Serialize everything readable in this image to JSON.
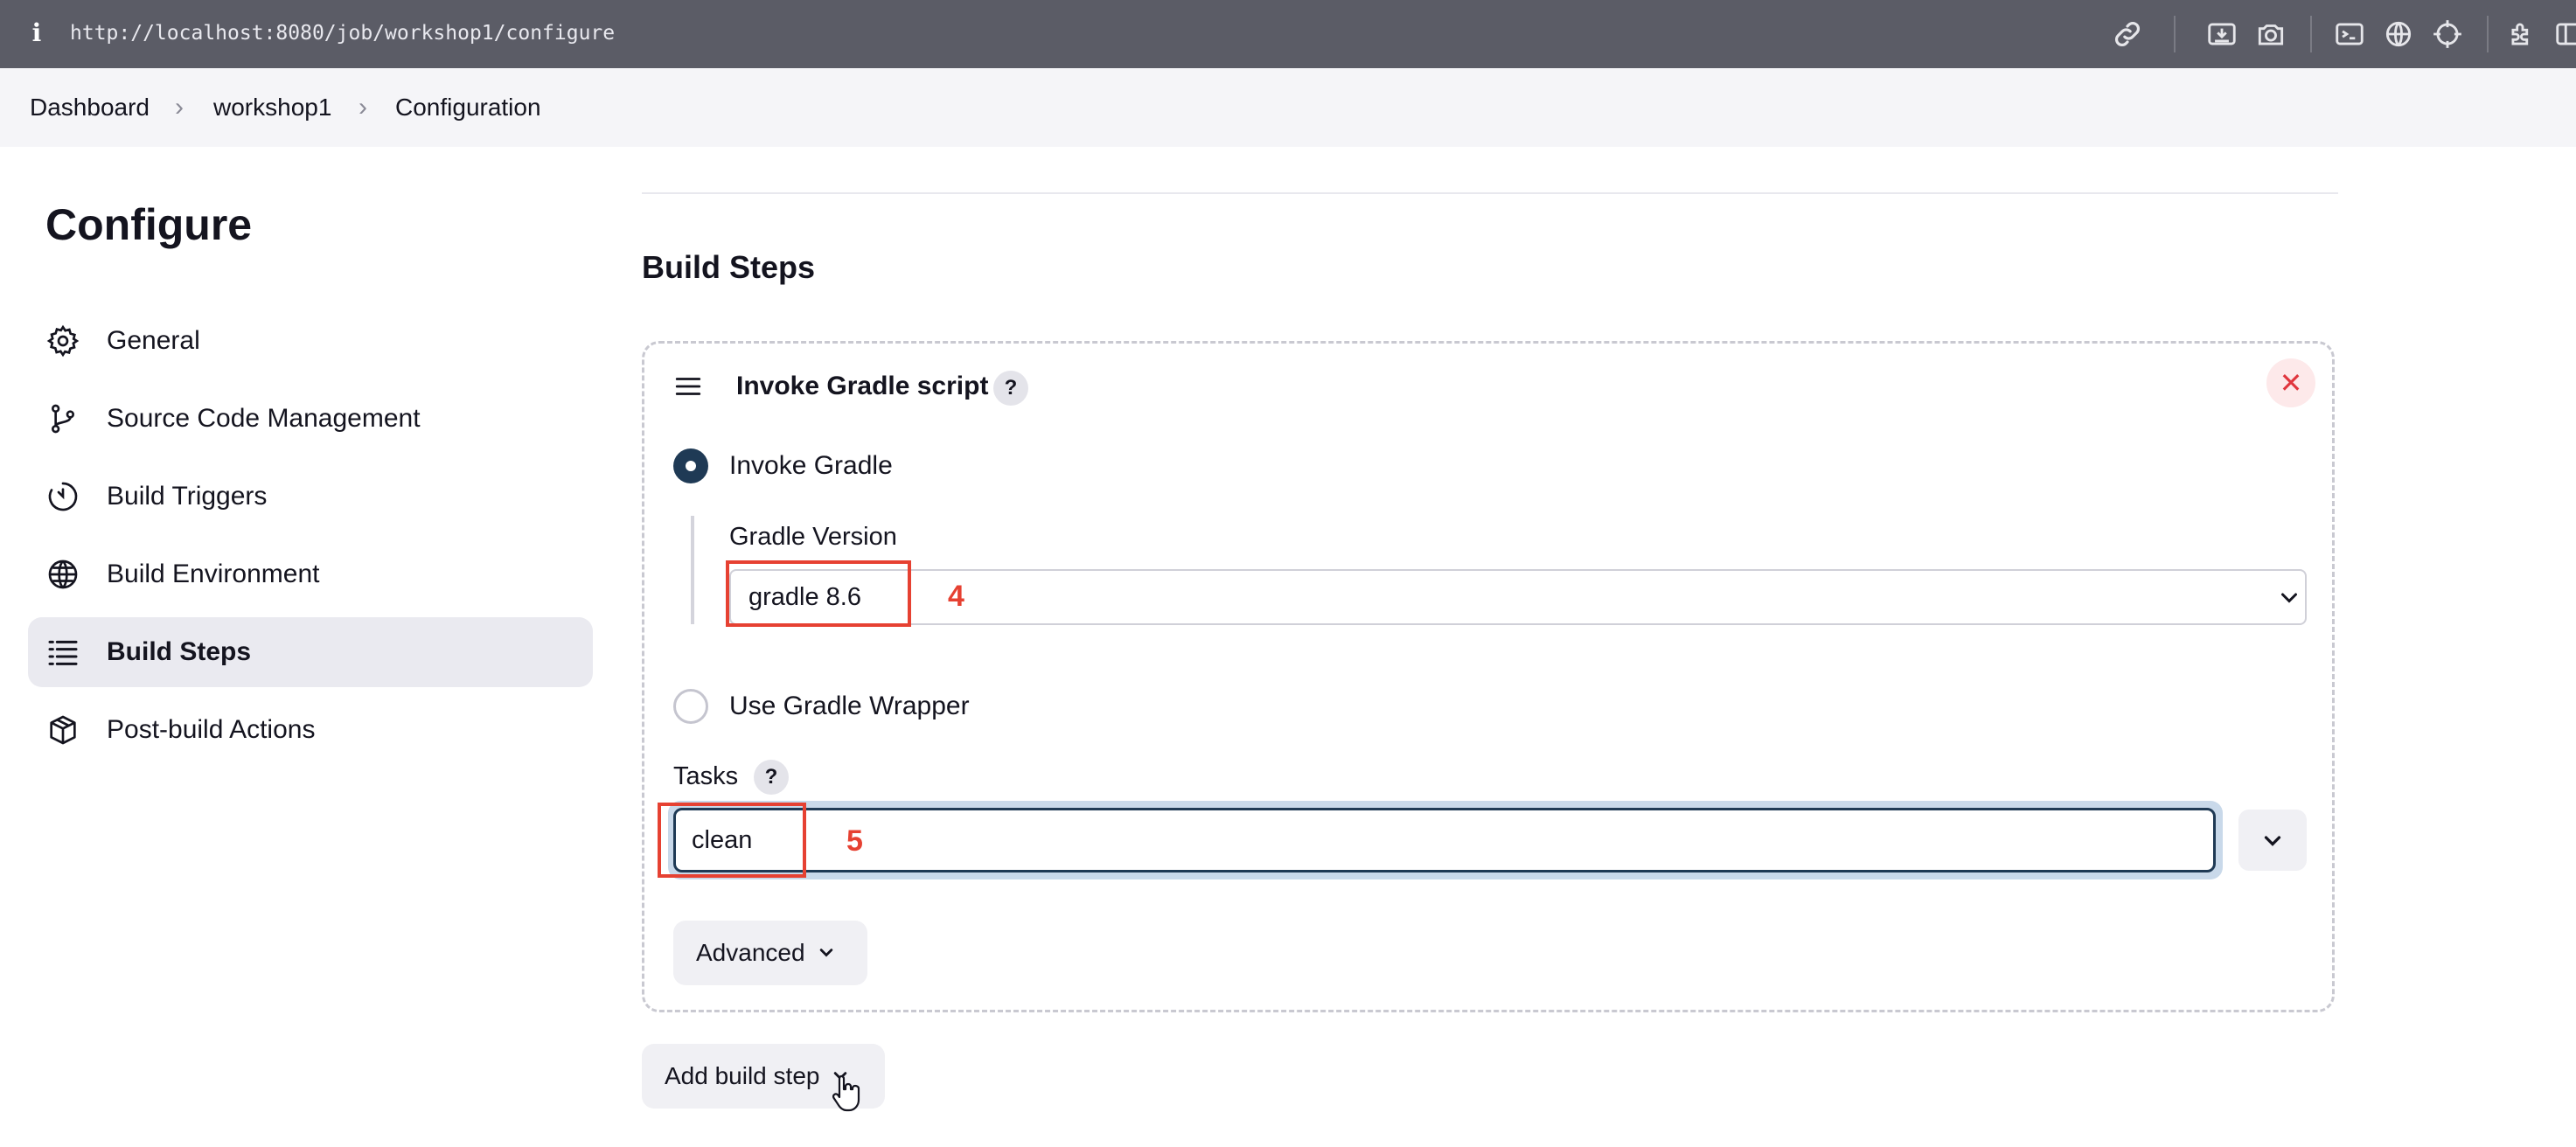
{
  "browser": {
    "url": "http://localhost:8080/job/workshop1/configure",
    "toolbar_icons": [
      "link-icon",
      "screenshot-icon",
      "camera-icon",
      "terminal-icon",
      "globe-icon",
      "crosshair-icon",
      "extensions-icon",
      "sidebar-icon"
    ]
  },
  "breadcrumb": [
    "Dashboard",
    "workshop1",
    "Configuration"
  ],
  "sidebar": {
    "title": "Configure",
    "items": [
      {
        "label": "General",
        "icon": "gear-icon"
      },
      {
        "label": "Source Code Management",
        "icon": "branch-icon"
      },
      {
        "label": "Build Triggers",
        "icon": "timer-icon"
      },
      {
        "label": "Build Environment",
        "icon": "globe-icon"
      },
      {
        "label": "Build Steps",
        "icon": "list-icon",
        "active": true
      },
      {
        "label": "Post-build Actions",
        "icon": "package-icon"
      }
    ]
  },
  "main": {
    "section_title": "Build Steps",
    "step": {
      "title": "Invoke Gradle script",
      "help": "?",
      "invoke_gradle_label": "Invoke Gradle",
      "gradle_version_label": "Gradle Version",
      "gradle_version_value": "gradle 8.6",
      "use_wrapper_label": "Use Gradle Wrapper",
      "tasks_label": "Tasks",
      "tasks_value": "clean",
      "advanced_label": "Advanced"
    },
    "add_build_step_label": "Add build step"
  },
  "annotations": {
    "first": "4",
    "second": "5",
    "color": "#e64132"
  },
  "colors": {
    "accent": "#1f3a55",
    "danger": "#e0363e",
    "focus_ring": "#c9d9ea"
  }
}
